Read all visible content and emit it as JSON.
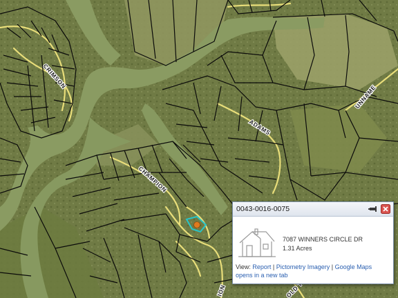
{
  "map": {
    "road_labels": {
      "crimson": "CRIMSON",
      "adams": "ADAMS",
      "champion": "CHAMPION",
      "unnamed": "UNNAME",
      "bottom_a": "ION",
      "bottom_b": "OLD T"
    },
    "colors": {
      "water": "#8a9b62",
      "land": "#6f7a44",
      "parcel_line": "#0a0a0a",
      "road": "#e9de7a",
      "selected_parcel": "#28c4c8",
      "marker": "#e07a1e"
    }
  },
  "popup": {
    "parcel_id": "0043-0016-0075",
    "address": "7087 WINNERS CIRCLE DR",
    "acres": "1.31 Acres",
    "view_label": "View:",
    "links": [
      "Report",
      "Pictometry Imagery",
      "Google Maps opens in a new tab"
    ],
    "separator": " | ",
    "icons": [
      "dock-icon",
      "close-icon",
      "house-icon"
    ]
  }
}
